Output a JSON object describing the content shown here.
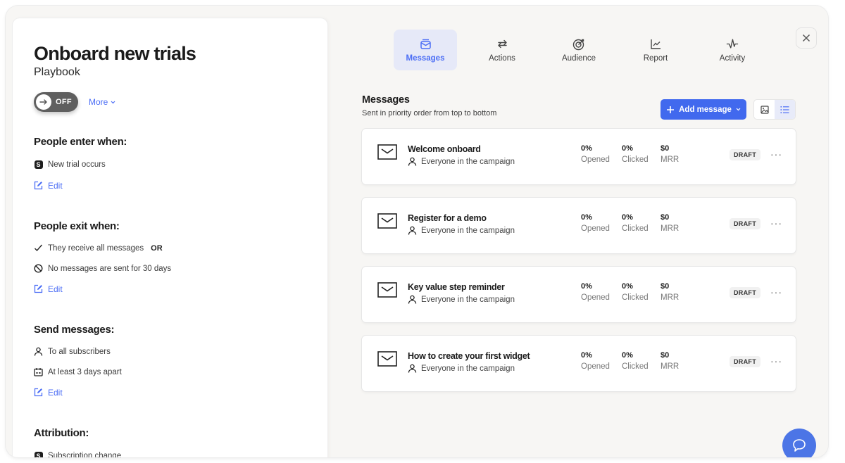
{
  "playbook": {
    "title": "Onboard new trials",
    "subtitle": "Playbook",
    "toggle_label": "OFF",
    "toggle_on": false,
    "more_label": "More"
  },
  "sections": {
    "enter": {
      "title": "People enter when:",
      "items": [
        {
          "icon": "s-badge-icon",
          "text": "New trial occurs"
        }
      ],
      "edit_label": "Edit"
    },
    "exit": {
      "title": "People exit when:",
      "items": [
        {
          "icon": "check-icon",
          "text": "They receive all messages",
          "suffix": "OR"
        },
        {
          "icon": "no-entry-icon",
          "text": "No messages are sent for 30 days"
        }
      ],
      "edit_label": "Edit"
    },
    "send": {
      "title": "Send messages:",
      "items": [
        {
          "icon": "person-icon",
          "text": "To all subscribers"
        },
        {
          "icon": "calendar-icon",
          "text": "At least 3 days apart"
        }
      ],
      "edit_label": "Edit"
    },
    "attribution": {
      "title": "Attribution:",
      "items": [
        {
          "icon": "s-badge-icon",
          "text": "Subscription change"
        }
      ]
    }
  },
  "tabs": [
    {
      "label": "Messages",
      "icon": "inbox-icon",
      "active": true
    },
    {
      "label": "Actions",
      "icon": "repeat-icon",
      "active": false
    },
    {
      "label": "Audience",
      "icon": "target-icon",
      "active": false
    },
    {
      "label": "Report",
      "icon": "chart-icon",
      "active": false
    },
    {
      "label": "Activity",
      "icon": "pulse-icon",
      "active": false
    }
  ],
  "messages": {
    "title": "Messages",
    "subtitle": "Sent in priority order from top to bottom",
    "add_label": "Add message",
    "view_mode": "list",
    "stat_labels": {
      "opened": "Opened",
      "clicked": "Clicked",
      "mrr": "MRR"
    },
    "items": [
      {
        "name": "Welcome onboard",
        "audience": "Everyone in the campaign",
        "opened": "0%",
        "clicked": "0%",
        "mrr": "$0",
        "status": "DRAFT"
      },
      {
        "name": "Register for a demo",
        "audience": "Everyone in the campaign",
        "opened": "0%",
        "clicked": "0%",
        "mrr": "$0",
        "status": "DRAFT"
      },
      {
        "name": "Key value step reminder",
        "audience": "Everyone in the campaign",
        "opened": "0%",
        "clicked": "0%",
        "mrr": "$0",
        "status": "DRAFT"
      },
      {
        "name": "How to create your first widget",
        "audience": "Everyone in the campaign",
        "opened": "0%",
        "clicked": "0%",
        "mrr": "$0",
        "status": "DRAFT"
      }
    ]
  },
  "colors": {
    "accent": "#4169ee",
    "link": "#4c6ef5",
    "active_tab_bg": "#e6e9f8"
  }
}
